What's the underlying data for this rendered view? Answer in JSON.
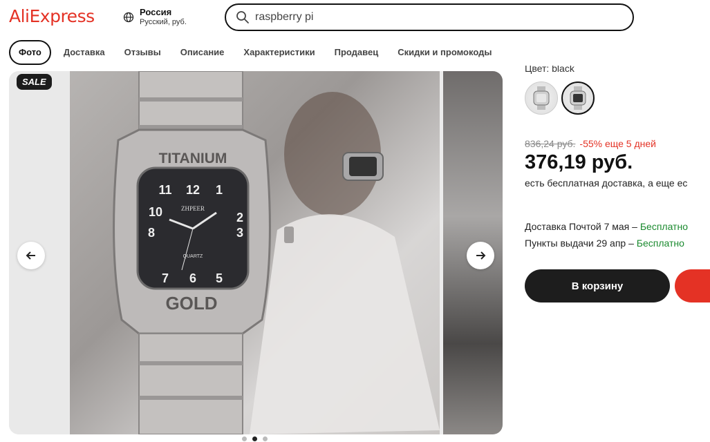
{
  "header": {
    "logo": "AliExpress",
    "region_country": "Россия",
    "region_details": "Русский, руб.",
    "search_value": "raspberry pi"
  },
  "tabs": [
    {
      "label": "Фото",
      "active": true
    },
    {
      "label": "Доставка"
    },
    {
      "label": "Отзывы"
    },
    {
      "label": "Описание"
    },
    {
      "label": "Характеристики"
    },
    {
      "label": "Продавец"
    },
    {
      "label": "Скидки и промокоды"
    }
  ],
  "gallery": {
    "sale_badge": "SALE",
    "watch_brand_top": "TITANIUM",
    "watch_brand_bottom": "GOLD",
    "watch_dial_brand": "ZHPEER",
    "watch_dial_movement": "QUARTZ",
    "dots_count": 3,
    "active_dot": 1
  },
  "product": {
    "color_label": "Цвет: black",
    "old_price": "836,24 руб.",
    "discount_text": "-55% еще 5 дней",
    "price": "376,19 руб.",
    "free_shipping": "есть бесплатная доставка, а еще ес",
    "delivery_post": "Доставка Почтой 7 мая – ",
    "delivery_post_status": "Бесплатно",
    "delivery_pickup": "Пункты выдачи 29 апр – ",
    "delivery_pickup_status": "Бесплатно",
    "cart_button": "В корзину"
  },
  "colors": {
    "brand": "#e43225",
    "green": "#1a8a2e",
    "dark": "#1d1d1d"
  }
}
